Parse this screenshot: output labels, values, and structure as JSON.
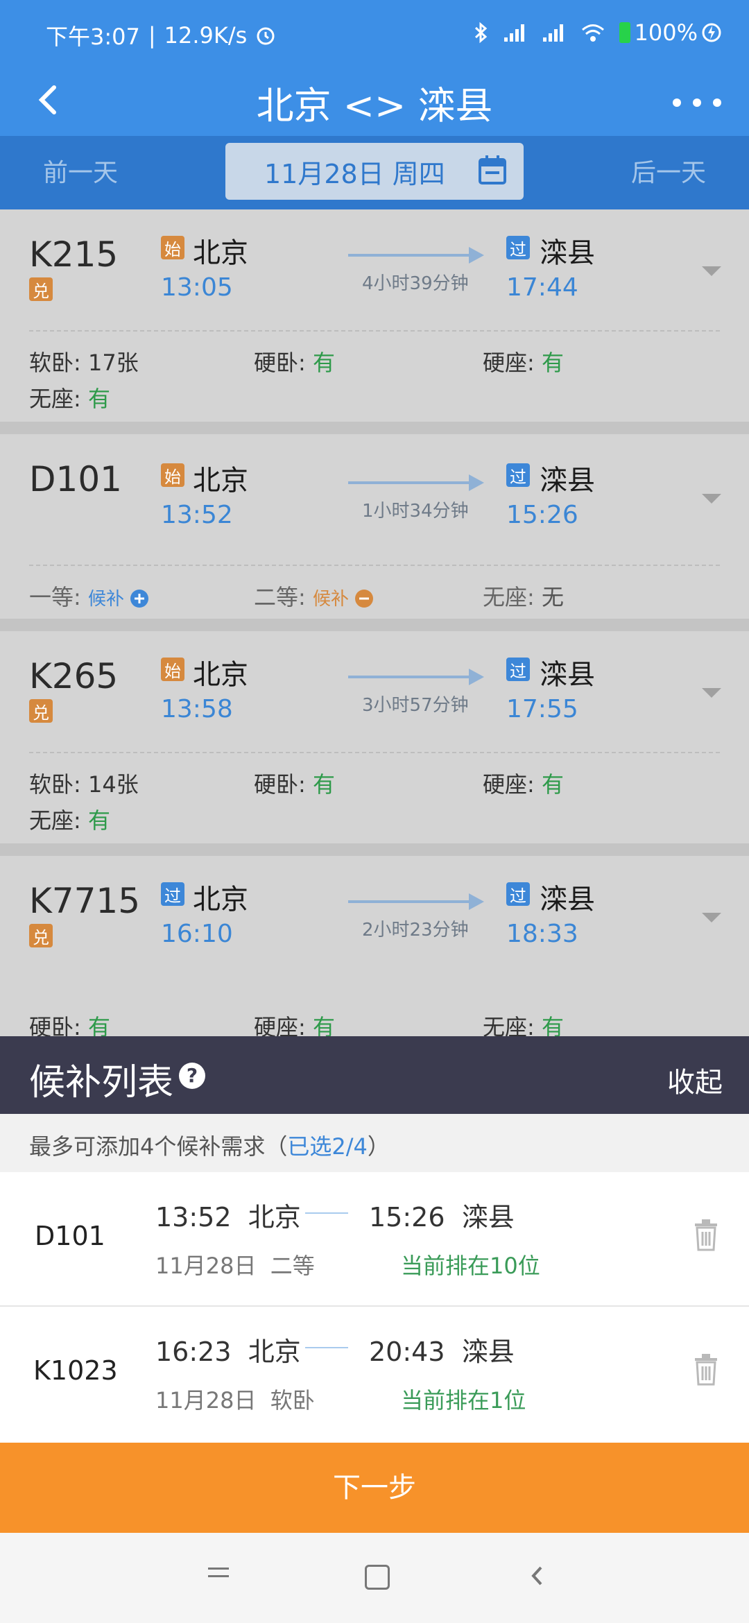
{
  "status_bar": {
    "time": "下午3:07",
    "speed": "12.9K/s",
    "battery": "100%"
  },
  "header": {
    "title": "北京 <> 滦县"
  },
  "date_bar": {
    "prev": "前一天",
    "date": "11月28日 周四",
    "next": "后一天"
  },
  "trains": [
    {
      "no": "K215",
      "exchange_badge": "兑",
      "from_tag": "始",
      "from": "北京",
      "dep": "13:05",
      "duration": "4小时39分钟",
      "to_tag": "过",
      "to": "滦县",
      "arr": "17:44",
      "seats": [
        {
          "label": "软卧:",
          "value": "17张"
        },
        {
          "label": "硬卧:",
          "value": "有"
        },
        {
          "label": "硬座:",
          "value": "有"
        },
        {
          "label": "无座:",
          "value": "有"
        }
      ]
    },
    {
      "no": "D101",
      "from_tag": "始",
      "from": "北京",
      "dep": "13:52",
      "duration": "1小时34分钟",
      "to_tag": "过",
      "to": "滦县",
      "arr": "15:26",
      "seats": [
        {
          "label": "一等:",
          "value": "候补"
        },
        {
          "label": "二等:",
          "value": "候补"
        },
        {
          "label": "无座:",
          "value": "无"
        }
      ]
    },
    {
      "no": "K265",
      "exchange_badge": "兑",
      "from_tag": "始",
      "from": "北京",
      "dep": "13:58",
      "duration": "3小时57分钟",
      "to_tag": "过",
      "to": "滦县",
      "arr": "17:55",
      "seats": [
        {
          "label": "软卧:",
          "value": "14张"
        },
        {
          "label": "硬卧:",
          "value": "有"
        },
        {
          "label": "硬座:",
          "value": "有"
        },
        {
          "label": "无座:",
          "value": "有"
        }
      ]
    },
    {
      "no": "K7715",
      "exchange_badge": "兑",
      "from_tag": "过",
      "from": "北京",
      "dep": "16:10",
      "duration": "2小时23分钟",
      "to_tag": "过",
      "to": "滦县",
      "arr": "18:33",
      "seats": [
        {
          "label": "硬卧:",
          "value": "有"
        },
        {
          "label": "硬座:",
          "value": "有"
        },
        {
          "label": "无座:",
          "value": "有"
        }
      ]
    }
  ],
  "waitlist": {
    "title": "候补列表",
    "help": "?",
    "collapse": "收起",
    "note_prefix": "最多可添加4个候补需求（",
    "note_selected": "已选2/4",
    "note_suffix": "）",
    "items": [
      {
        "no": "D101",
        "dep_time": "13:52",
        "dep_station": "北京",
        "arr_time": "15:26",
        "arr_station": "滦县",
        "date": "11月28日",
        "seat": "二等",
        "rank": "当前排在10位"
      },
      {
        "no": "K1023",
        "dep_time": "16:23",
        "dep_station": "北京",
        "arr_time": "20:43",
        "arr_station": "滦县",
        "date": "11月28日",
        "seat": "软卧",
        "rank": "当前排在1位"
      }
    ]
  },
  "next_button": "下一步"
}
